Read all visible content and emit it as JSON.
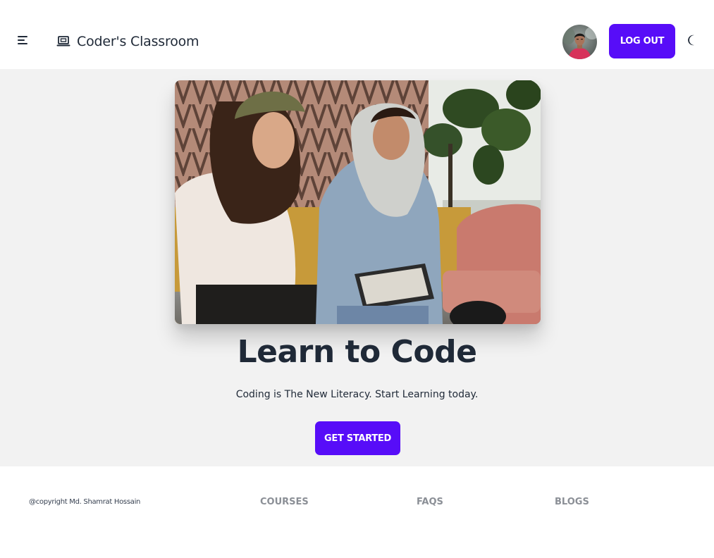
{
  "navbar": {
    "menu_icon": "hamburger-menu-icon",
    "brand_icon": "laptop-icon",
    "brand_title": "Coder's Classroom",
    "avatar_icon": "user-avatar",
    "logout_label": "LOG OUT",
    "theme_icon": "moon-icon"
  },
  "hero": {
    "image_alt": "Two women sitting together looking at a tablet",
    "title": "Learn to Code",
    "subtitle": "Coding is The New Literacy. Start Learning today.",
    "cta_label": "GET STARTED"
  },
  "footer": {
    "copyright": "@copyright Md. Shamrat Hossain",
    "links": [
      {
        "label": "COURSES"
      },
      {
        "label": "FAQS"
      },
      {
        "label": "BLOGS"
      }
    ]
  },
  "colors": {
    "primary": "#570df8",
    "hero_bg": "#f2f2f2",
    "text": "#1f2937",
    "footer_link": "#8b8f96"
  }
}
